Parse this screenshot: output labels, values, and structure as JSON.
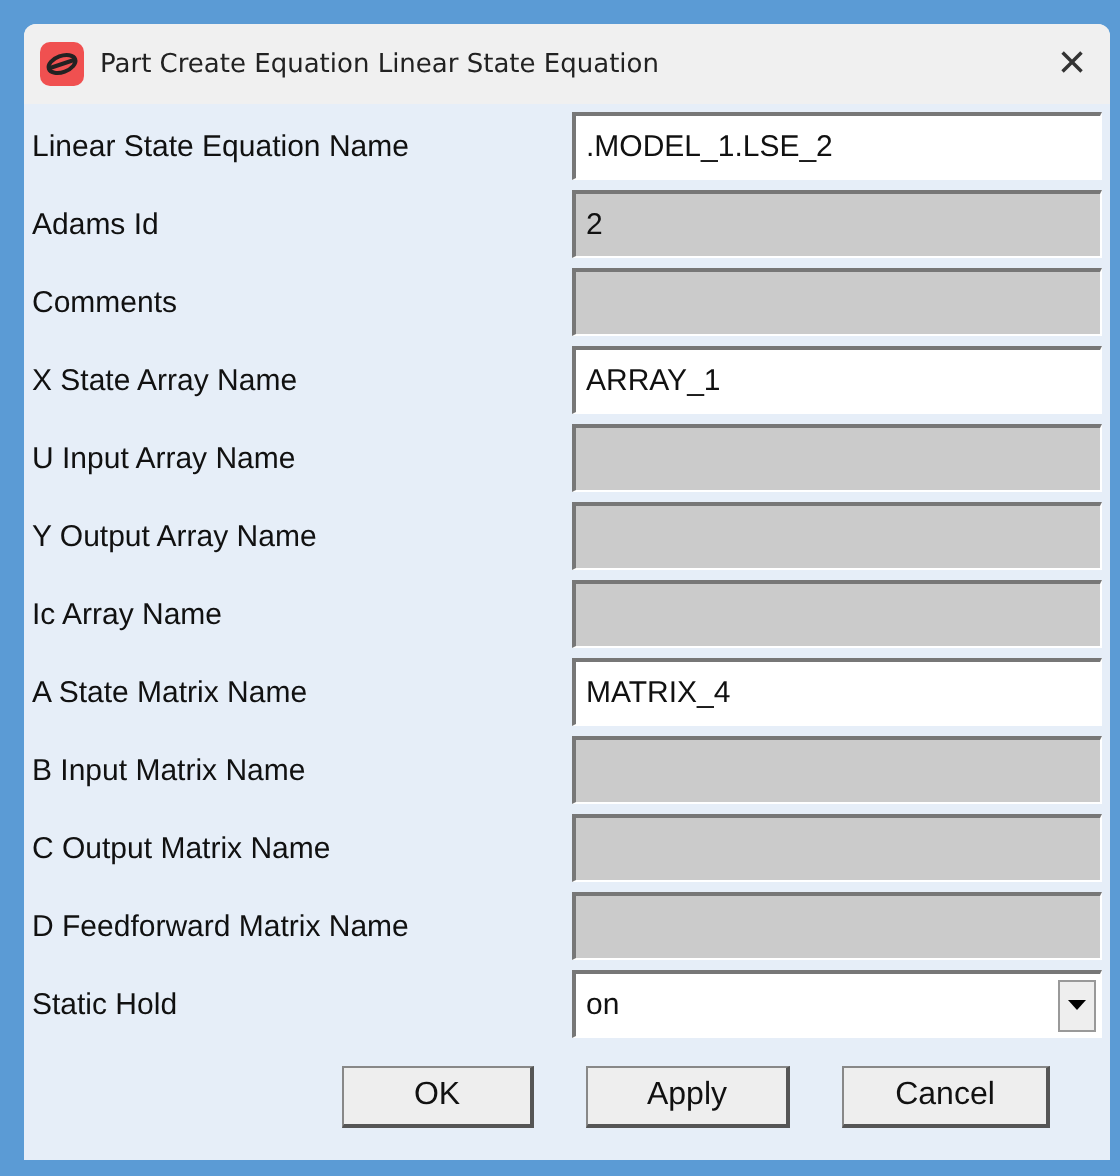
{
  "window": {
    "title": "Part Create Equation Linear State Equation",
    "close": "×"
  },
  "fields": [
    {
      "label": "Linear State Equation Name",
      "kind": "text",
      "value": ".MODEL_1.LSE_2",
      "disabled": false
    },
    {
      "label": "Adams Id",
      "kind": "text",
      "value": "2",
      "disabled": true
    },
    {
      "label": "Comments",
      "kind": "text",
      "disabled": true
    },
    {
      "label": "X State Array Name",
      "kind": "text",
      "value": "ARRAY_1",
      "disabled": false
    },
    {
      "label": "U Input Array Name",
      "kind": "text",
      "disabled": true
    },
    {
      "label": "Y Output Array Name",
      "kind": "text",
      "disabled": true
    },
    {
      "label": "Ic Array Name",
      "kind": "text",
      "disabled": true
    },
    {
      "label": "A State Matrix Name",
      "kind": "text",
      "value": "MATRIX_4",
      "disabled": false
    },
    {
      "label": "B Input Matrix Name",
      "kind": "text",
      "disabled": true
    },
    {
      "label": "C Output Matrix Name",
      "kind": "text",
      "disabled": true
    },
    {
      "label": "D Feedforward Matrix Name",
      "kind": "text",
      "disabled": true
    },
    {
      "label": "Static Hold",
      "kind": "dropdown",
      "value": "on",
      "disabled": false
    }
  ],
  "buttons": [
    "OK",
    "Apply",
    "Cancel"
  ]
}
